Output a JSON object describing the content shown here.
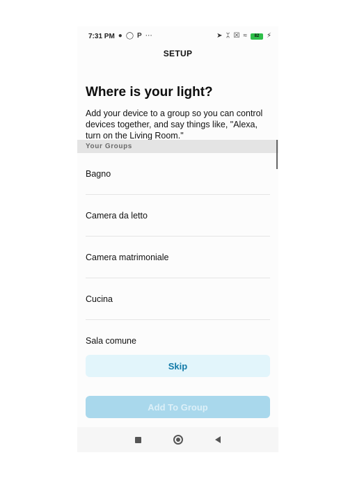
{
  "status_bar": {
    "time": "7:31 PM",
    "left_icons": [
      "chat-icon",
      "lightbulb-icon",
      "p-icon",
      "more-dots-icon"
    ],
    "right_icons": [
      "location-arrow-icon",
      "bluetooth-icon",
      "sim-x-icon",
      "wifi-icon"
    ],
    "battery": "82",
    "battery_color": "#2fbf4a"
  },
  "header": {
    "title": "SETUP"
  },
  "main": {
    "title": "Where is your light?",
    "description": "Add your device to a group so you can control devices together, and say things like, \"Alexa, turn on the Living Room.\""
  },
  "groups": {
    "section_label": "Your Groups",
    "items": [
      {
        "label": "Bagno"
      },
      {
        "label": "Camera da letto"
      },
      {
        "label": "Camera matrimoniale"
      },
      {
        "label": "Cucina"
      },
      {
        "label": "Sala comune"
      }
    ]
  },
  "actions": {
    "skip_label": "Skip",
    "add_label": "Add To Group",
    "accent_color": "#127aa8",
    "disabled_color": "#a9d8ec"
  },
  "nav_bar": {
    "icons": [
      "recents-square-icon",
      "home-circle-icon",
      "back-triangle-icon"
    ]
  }
}
